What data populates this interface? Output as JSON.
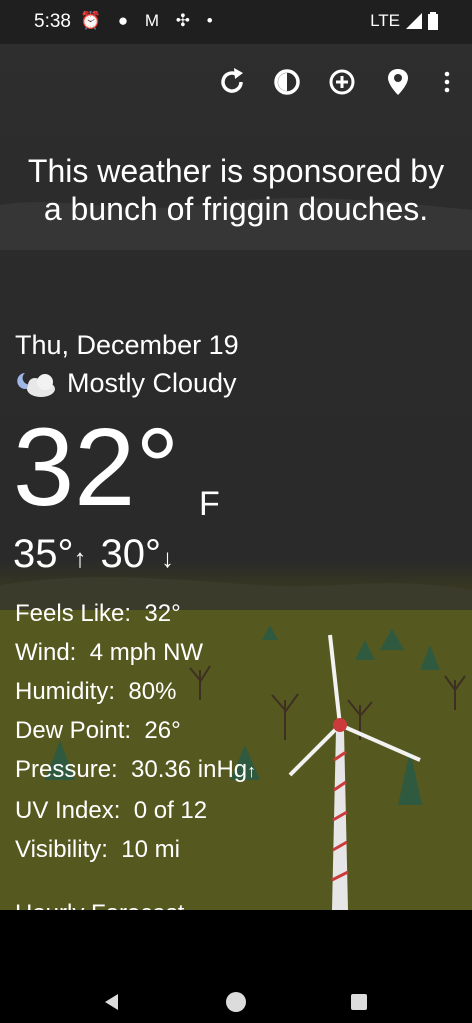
{
  "status": {
    "time": "5:38",
    "notification_icons": [
      "alarm-icon",
      "messenger-icon",
      "gmail-icon",
      "fan-icon",
      "dot-icon"
    ],
    "network": "LTE"
  },
  "toolbar": {
    "icons": [
      "refresh-icon",
      "theme-icon",
      "add-location-icon",
      "location-pin-icon",
      "overflow-menu-icon"
    ]
  },
  "sponsor": {
    "text": "This weather is sponsored by a bunch of friggin douches."
  },
  "current": {
    "date": "Thu, December 19",
    "condition": "Mostly Cloudy",
    "condition_icon": "partly-cloudy-night-icon",
    "temperature": "32°",
    "unit": "F",
    "high": "35°",
    "low": "30°"
  },
  "details": [
    {
      "label": "Feels Like:",
      "value": "32°"
    },
    {
      "label": "Wind:",
      "value": "4 mph NW"
    },
    {
      "label": "Humidity:",
      "value": "80%"
    },
    {
      "label": "Dew Point:",
      "value": "26°"
    },
    {
      "label": "Pressure:",
      "value": "30.36 inHg",
      "trend": "↑"
    },
    {
      "label": "UV Index:",
      "value": "0 of 12"
    },
    {
      "label": "Visibility:",
      "value": "10 mi"
    }
  ],
  "next_section": "Hourly Forecast",
  "navbar": [
    "back-icon",
    "home-icon",
    "recents-icon"
  ],
  "colors": {
    "text": "#ffffff",
    "statusbar": "#1f1f1f",
    "field": "#5b5f22"
  }
}
